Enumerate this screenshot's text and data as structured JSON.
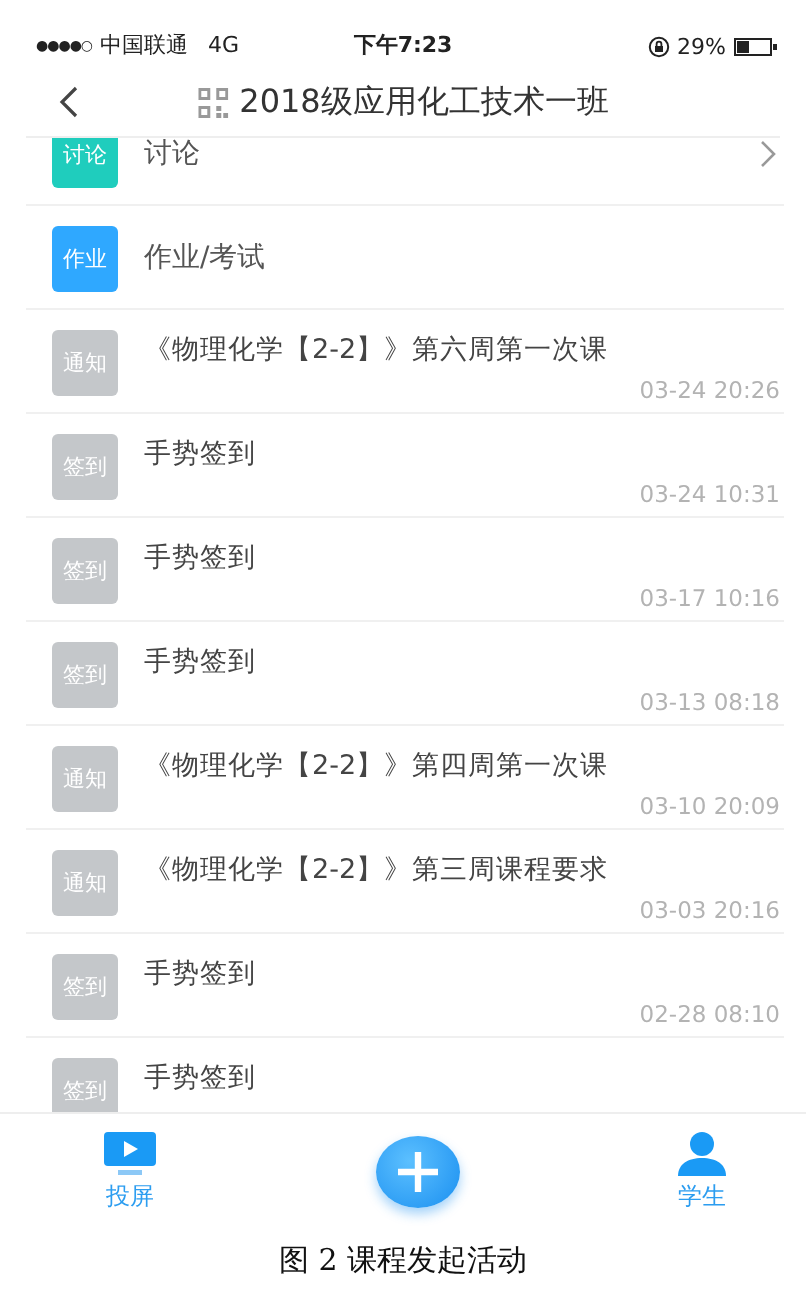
{
  "status_bar": {
    "signal": "●●●●○",
    "carrier": "中国联通",
    "network": "4G",
    "time": "下午7:23",
    "battery": "29%"
  },
  "nav": {
    "title": "2018级应用化工技术一班"
  },
  "items": [
    {
      "kind": "entry",
      "badge": "讨论",
      "color": "#1fcdbd",
      "title": "讨论"
    },
    {
      "kind": "entry",
      "badge": "作业",
      "color": "#2fa8ff",
      "title": "作业/考试"
    },
    {
      "kind": "activity",
      "badge": "通知",
      "color": "#c4c7ca",
      "title": "《物理化学【2-2】》第六周第一次课",
      "time": "03-24 20:26"
    },
    {
      "kind": "activity",
      "badge": "签到",
      "color": "#c4c7ca",
      "title": "手势签到",
      "time": "03-24 10:31"
    },
    {
      "kind": "activity",
      "badge": "签到",
      "color": "#c4c7ca",
      "title": "手势签到",
      "time": "03-17 10:16"
    },
    {
      "kind": "activity",
      "badge": "签到",
      "color": "#c4c7ca",
      "title": "手势签到",
      "time": "03-13 08:18"
    },
    {
      "kind": "activity",
      "badge": "通知",
      "color": "#c4c7ca",
      "title": "《物理化学【2-2】》第四周第一次课",
      "time": "03-10 20:09"
    },
    {
      "kind": "activity",
      "badge": "通知",
      "color": "#c4c7ca",
      "title": "《物理化学【2-2】》第三周课程要求",
      "time": "03-03 20:16"
    },
    {
      "kind": "activity",
      "badge": "签到",
      "color": "#c4c7ca",
      "title": "手势签到",
      "time": "02-28 08:10"
    },
    {
      "kind": "activity",
      "badge": "签到",
      "color": "#c4c7ca",
      "title": "手势签到"
    }
  ],
  "tab_bar": [
    {
      "kind": "screen",
      "label": "投屏"
    },
    {
      "kind": "add"
    },
    {
      "kind": "students",
      "label": "学生"
    }
  ],
  "caption": "图 2 课程发起活动"
}
